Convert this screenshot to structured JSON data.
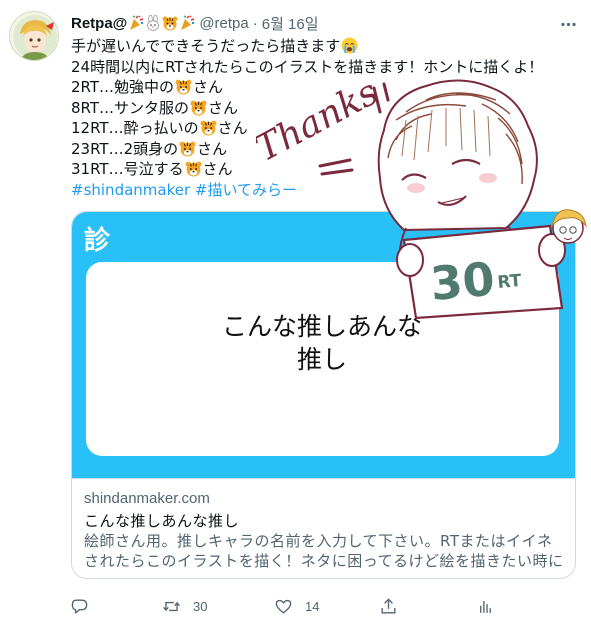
{
  "author": {
    "display_name": "Retpa@",
    "handle": "@retpa",
    "separator": "·",
    "date": "6월 16일"
  },
  "tweet": {
    "lines": [
      {
        "text": "手が遅いんでできそうだったら描きます",
        "suffix_emoji": "crying-face-icon"
      },
      {
        "text": "24時間以内にRTされたらこのイラストを描きます！ホントに描くよ！"
      },
      {
        "prefix": "2RT…勉強中の",
        "suffix": "さん"
      },
      {
        "prefix": "8RT…サンタ服の",
        "suffix": "さん"
      },
      {
        "prefix": "12RT…酔っ払いの",
        "suffix": "さん"
      },
      {
        "prefix": "23RT…2頭身の",
        "suffix": "さん"
      },
      {
        "prefix": "31RT…号泣する",
        "suffix": "さん"
      }
    ],
    "hashtags": [
      "#shindanmaker",
      "#描いてみらー"
    ]
  },
  "card": {
    "image_title_line1": "こんな推しあんな",
    "image_title_line2": "推し",
    "logo_text": "診",
    "domain": "shindanmaker.com",
    "title": "こんな推しあんな推し",
    "description": "絵師さん用。推しキャラの名前を入力して下さい。RTまたはイイネされたらこのイラストを描く！ネタに困ってるけど絵を描きたい時にご…",
    "accent_color": "#29c0f8"
  },
  "drawing": {
    "thanks_text": "Thanks",
    "sign_text": "30",
    "sign_suffix": "RT",
    "ink_color": "#7a2a3c",
    "sign_color": "#4f7a6d"
  },
  "actions": {
    "reply_count": "",
    "retweet_count": "30",
    "like_count": "14"
  },
  "colors": {
    "text": "#0f1419",
    "secondary": "#536471",
    "link": "#1d9bf0",
    "border": "#cfd9de"
  }
}
